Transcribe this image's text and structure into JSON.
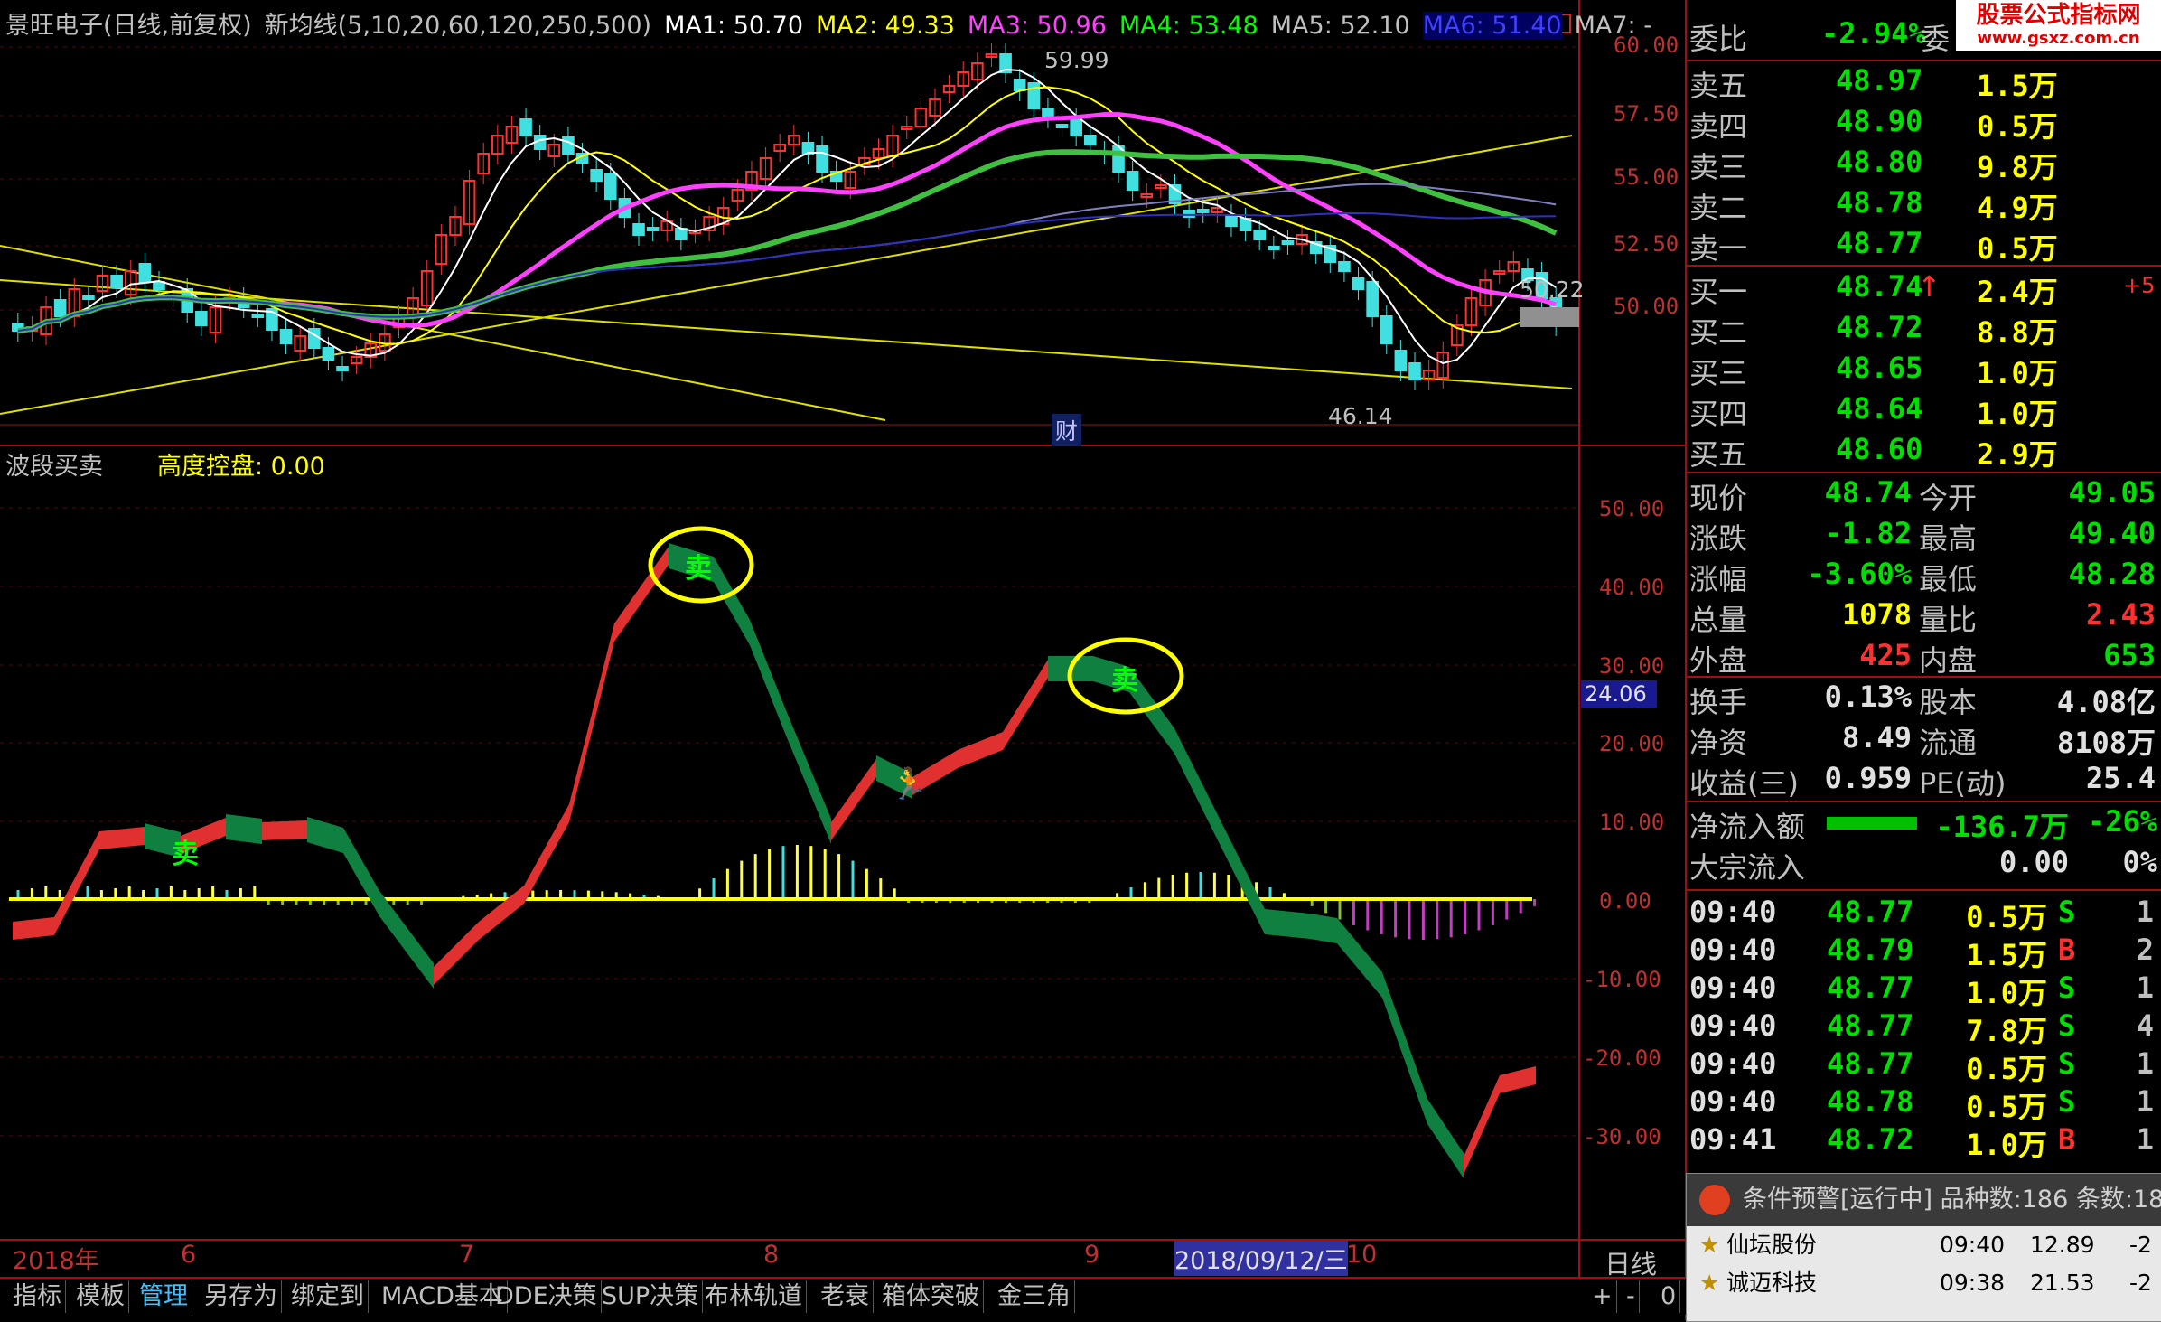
{
  "header": {
    "title": "景旺电子(日线,前复权)",
    "indicator": "新均线(5,10,20,60,120,250,500)",
    "ma": [
      {
        "label": "MA1: 50.70",
        "color": "#ffffff"
      },
      {
        "label": "MA2: 49.33",
        "color": "#ffff00"
      },
      {
        "label": "MA3: 50.96",
        "color": "#ff40ff"
      },
      {
        "label": "MA4: 53.48",
        "color": "#00ff00"
      },
      {
        "label": "MA5: 52.10",
        "color": "#c0c0c0"
      },
      {
        "label": "MA6: 51.40",
        "color": "#4040ff"
      },
      {
        "label": "MA7: -",
        "color": "#c0c0c0"
      }
    ]
  },
  "main_chart": {
    "price_axis": [
      "60.00",
      "57.50",
      "55.00",
      "52.50",
      "50.00"
    ],
    "high_label": "59.99",
    "low_label": "46.14",
    "current_label": "50.22",
    "cai_label": "财"
  },
  "sub_chart": {
    "name": "波段买卖",
    "param": "高度控盘: 0.00",
    "axis": [
      "50.00",
      "40.00",
      "30.00",
      "20.00",
      "10.00",
      "0.00",
      "-10.00",
      "-20.00",
      "-30.00"
    ],
    "current_value": "24.06",
    "signal_sell": "卖"
  },
  "dates": [
    "2018年",
    "6",
    "7",
    "8",
    "9",
    "2018/09/12/三",
    "10"
  ],
  "period_label": "日线",
  "toolbar": [
    "指标",
    "模板",
    "管理",
    "另存为",
    "绑定到",
    "MACD基本",
    "DDE决策",
    "SUP决策",
    "布林轨道",
    "老衰",
    "箱体突破",
    "金三角"
  ],
  "toolbar_right": [
    "+",
    "-",
    "0"
  ],
  "quote": {
    "weibi_label": "委比",
    "weibi_value": "-2.94%",
    "weicha_label": "委",
    "sell": [
      {
        "label": "卖五",
        "price": "48.97",
        "vol": "1.5万"
      },
      {
        "label": "卖四",
        "price": "48.90",
        "vol": "0.5万"
      },
      {
        "label": "卖三",
        "price": "48.80",
        "vol": "9.8万"
      },
      {
        "label": "卖二",
        "price": "48.78",
        "vol": "4.9万"
      },
      {
        "label": "卖一",
        "price": "48.77",
        "vol": "0.5万"
      }
    ],
    "buy": [
      {
        "label": "买一",
        "price": "48.74",
        "vol": "2.4万",
        "extra": "+5"
      },
      {
        "label": "买二",
        "price": "48.72",
        "vol": "8.8万",
        "extra": ""
      },
      {
        "label": "买三",
        "price": "48.65",
        "vol": "1.0万",
        "extra": ""
      },
      {
        "label": "买四",
        "price": "48.64",
        "vol": "1.0万",
        "extra": ""
      },
      {
        "label": "买五",
        "price": "48.60",
        "vol": "2.9万",
        "extra": ""
      }
    ],
    "stats": [
      {
        "l1": "现价",
        "v1": "48.74",
        "l2": "今开",
        "v2": "49.05"
      },
      {
        "l1": "涨跌",
        "v1": "-1.82",
        "l2": "最高",
        "v2": "49.40"
      },
      {
        "l1": "涨幅",
        "v1": "-3.60%",
        "l2": "最低",
        "v2": "48.28"
      },
      {
        "l1": "总量",
        "v1": "1078",
        "l2": "量比",
        "v2": "2.43"
      },
      {
        "l1": "外盘",
        "v1": "425",
        "l2": "内盘",
        "v2": "653"
      }
    ],
    "fund": [
      {
        "l1": "换手",
        "v1": "0.13%",
        "l2": "股本",
        "v2": "4.08亿"
      },
      {
        "l1": "净资",
        "v1": "8.49",
        "l2": "流通",
        "v2": "8108万"
      },
      {
        "l1": "收益(三)",
        "v1": "0.959",
        "l2": "PE(动)",
        "v2": "25.4"
      }
    ],
    "flow": [
      {
        "label": "净流入额",
        "v1": "-136.7万",
        "v2": "-26%"
      },
      {
        "label": "大宗流入",
        "v1": "0.00",
        "v2": "0%"
      }
    ],
    "ticks": [
      {
        "time": "09:40",
        "price": "48.77",
        "vol": "0.5万",
        "bs": "S",
        "n": "1"
      },
      {
        "time": "09:40",
        "price": "48.79",
        "vol": "1.5万",
        "bs": "B",
        "n": "2"
      },
      {
        "time": "09:40",
        "price": "48.77",
        "vol": "1.0万",
        "bs": "S",
        "n": "1"
      },
      {
        "time": "09:40",
        "price": "48.77",
        "vol": "7.8万",
        "bs": "S",
        "n": "4"
      },
      {
        "time": "09:40",
        "price": "48.77",
        "vol": "0.5万",
        "bs": "S",
        "n": "1"
      },
      {
        "time": "09:40",
        "price": "48.78",
        "vol": "0.5万",
        "bs": "S",
        "n": "1"
      },
      {
        "time": "09:41",
        "price": "48.72",
        "vol": "1.0万",
        "bs": "B",
        "n": "1"
      }
    ]
  },
  "alert": {
    "title": "条件预警[运行中] 品种数:186 条数:18",
    "rows": [
      {
        "name": "仙坛股份",
        "time": "09:40",
        "price": "12.89",
        "chg": "-2"
      },
      {
        "name": "诚迈科技",
        "time": "09:38",
        "price": "21.53",
        "chg": "-2"
      }
    ]
  },
  "logo": {
    "main": "股票公式指标网",
    "sub": "www.gsxz.com.cn"
  },
  "colors": {
    "up": "#ff3030",
    "down": "#40e0e0",
    "grid": "#a01010",
    "bg": "#000000"
  }
}
